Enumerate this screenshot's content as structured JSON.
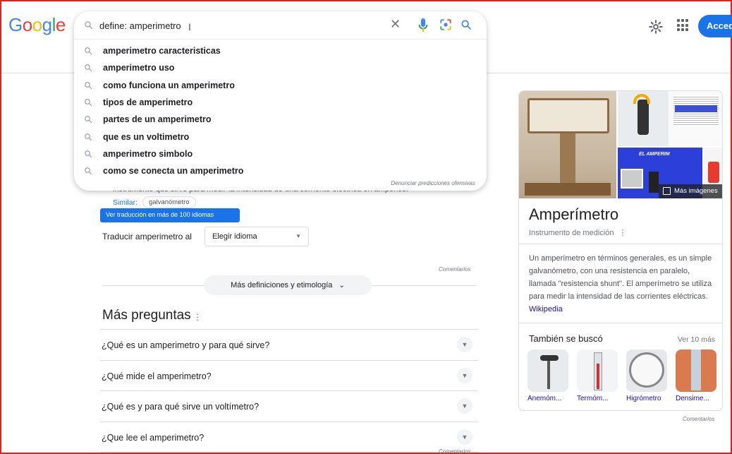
{
  "logo": {
    "text": "Google",
    "letters": [
      {
        "ch": "G",
        "color": "#4285f4"
      },
      {
        "ch": "o",
        "color": "#ea4335"
      },
      {
        "ch": "o",
        "color": "#fbbc05"
      },
      {
        "ch": "g",
        "color": "#4285f4"
      },
      {
        "ch": "l",
        "color": "#34a853"
      },
      {
        "ch": "e",
        "color": "#ea4335"
      }
    ]
  },
  "search": {
    "value": "define: amperimetro",
    "suggestions": [
      "amperimetro caracteristicas",
      "amperimetro uso",
      "como funciona un amperimetro",
      "tipos de amperimetro",
      "partes de un amperimetro",
      "que es un voltimetro",
      "amperimetro simbolo",
      "como se conecta un amperimetro"
    ],
    "report_label": "Denunciar predicciones ofensivas"
  },
  "header": {
    "login_label": "Acceder"
  },
  "definition": {
    "hidden_line": "instrumento que sirve para medir la intensidad de una corriente eléctrica en amperios.",
    "similar_label": "Similar:",
    "similar_chip": "galvanómetro",
    "tooltip": "Ver traducción en más de 100 idiomas",
    "translate_label": "Traducir amperimetro al",
    "language_select": "Elegir idioma",
    "feedback": "Comentarios",
    "more_defs": "Más definiciones y etimología"
  },
  "people_also_ask": {
    "title": "Más preguntas",
    "questions": [
      "¿Qué es un amperimetro y para qué sirve?",
      "¿Qué mide el amperimetro?",
      "¿Qué es y para qué sirve un voltímetro?",
      "¿Que lee el amperimetro?"
    ],
    "feedback": "Comentarios"
  },
  "knowledge_panel": {
    "image_caption": "EL AMPERIM",
    "more_images": "Más imágenes",
    "title": "Amperímetro",
    "subtitle": "Instrumento de medición",
    "description": "Un amperímetro en términos generales, es un simple galvanómetro, con una resistencia en paralelo, llamada \"resistencia shunt\". El amperímetro se utiliza para medir la intensidad de las corrientes eléctricas.",
    "source": "Wikipedia",
    "also_searched_title": "También se buscó",
    "also_searched_more": "Ver 10 más",
    "also_searched": [
      "Anemóm...",
      "Termóm...",
      "Higrómetro",
      "Densime..."
    ],
    "feedback": "Comentarios"
  },
  "colors": {
    "accent": "#1a73e8",
    "link": "#1a0dab",
    "frame": "#dd2222"
  }
}
